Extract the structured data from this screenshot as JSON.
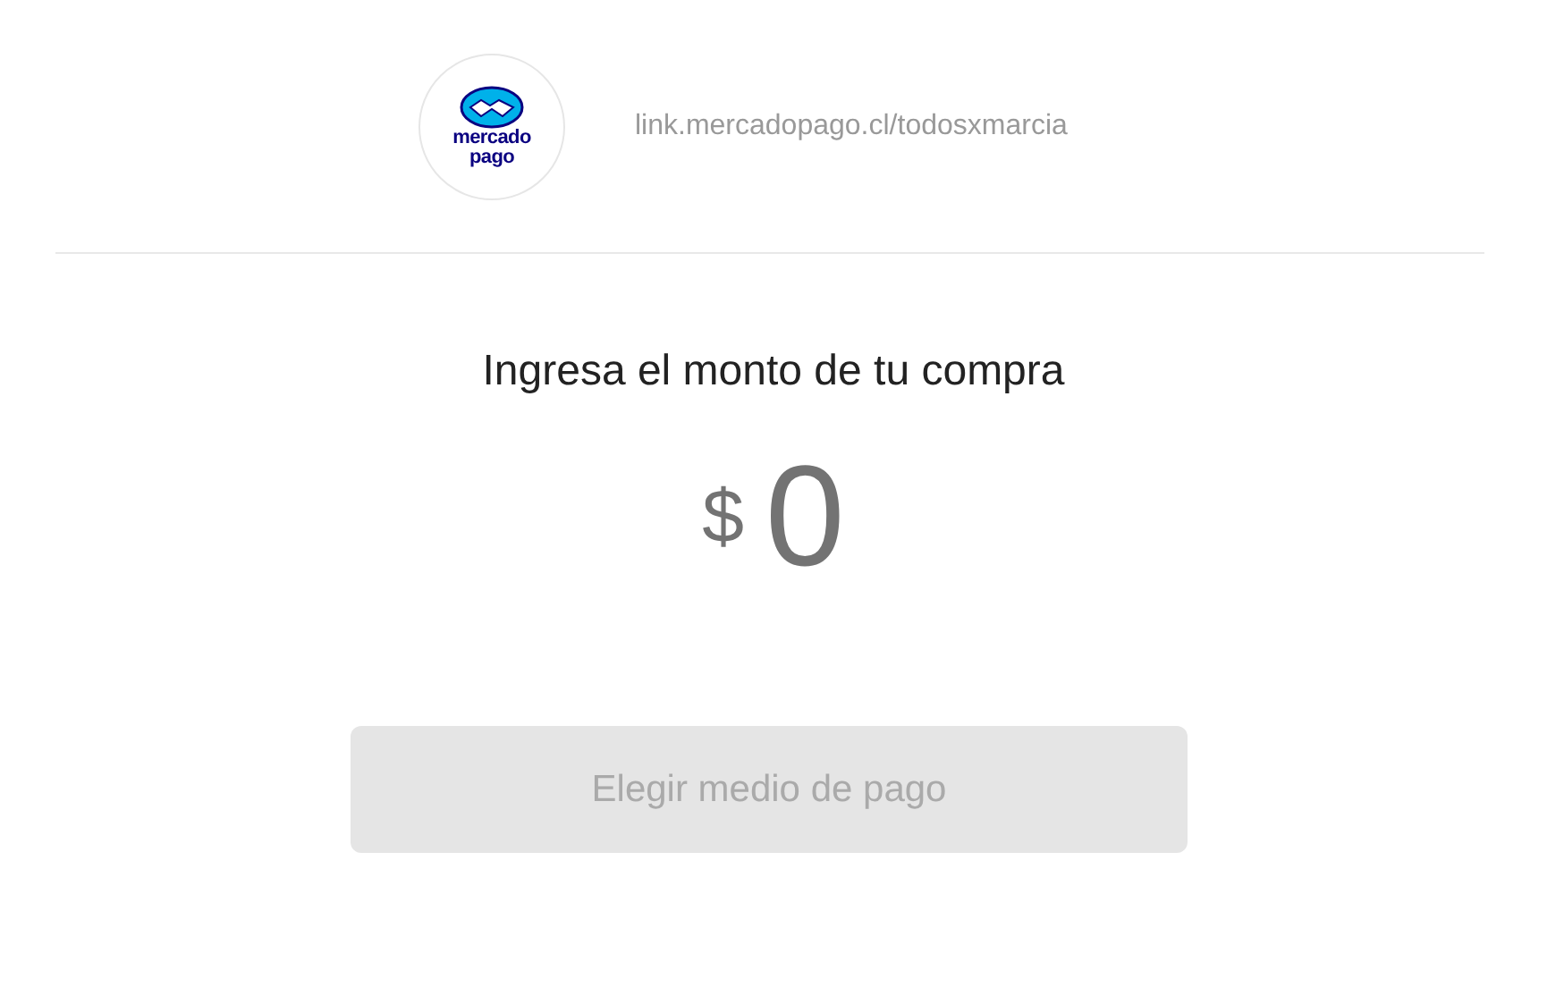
{
  "header": {
    "logo": {
      "line_1": "mercado",
      "line_2": "pago"
    },
    "link": "link.mercadopago.cl/todosxmarcia"
  },
  "title": "Ingresa el monto de tu compra",
  "amount": {
    "currency": "$",
    "value": "0"
  },
  "button": {
    "label": "Elegir medio de pago",
    "disabled": true
  }
}
